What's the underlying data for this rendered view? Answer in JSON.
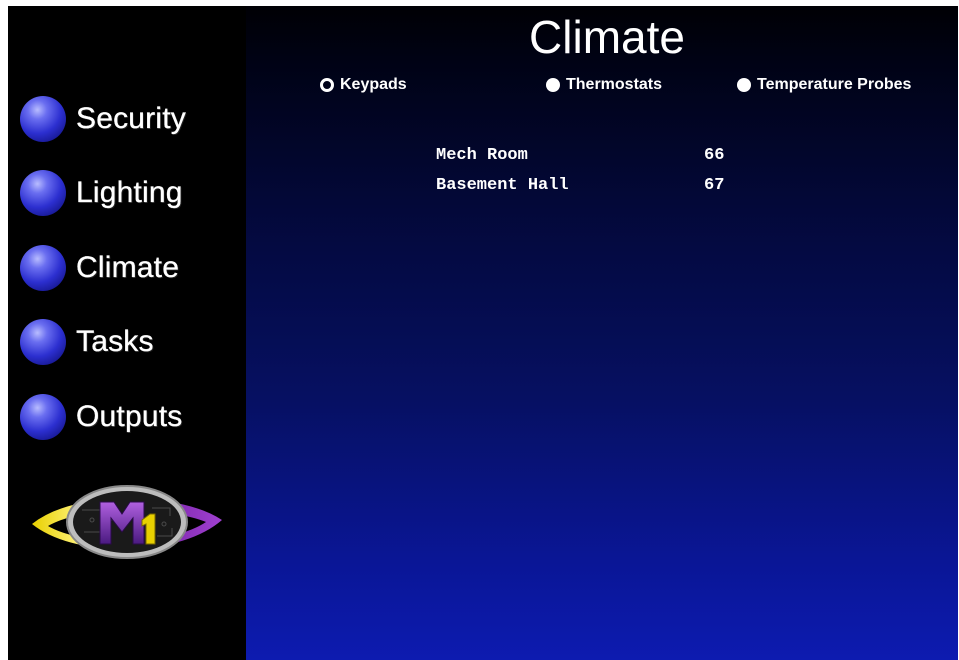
{
  "sidebar": {
    "items": [
      {
        "label": "Security"
      },
      {
        "label": "Lighting"
      },
      {
        "label": "Climate"
      },
      {
        "label": "Tasks"
      },
      {
        "label": "Outputs"
      }
    ],
    "logo_text": "M1"
  },
  "header": {
    "title": "Climate"
  },
  "tabs": [
    {
      "label": "Keypads",
      "selected": true
    },
    {
      "label": "Thermostats",
      "selected": false
    },
    {
      "label": "Temperature Probes",
      "selected": false
    }
  ],
  "probes": [
    {
      "name": "Mech Room",
      "value": "66"
    },
    {
      "name": "Basement Hall",
      "value": "67"
    }
  ],
  "colors": {
    "accent": "#2c2fd0",
    "background_top": "#000004",
    "background_bottom": "#0d1bb0"
  }
}
